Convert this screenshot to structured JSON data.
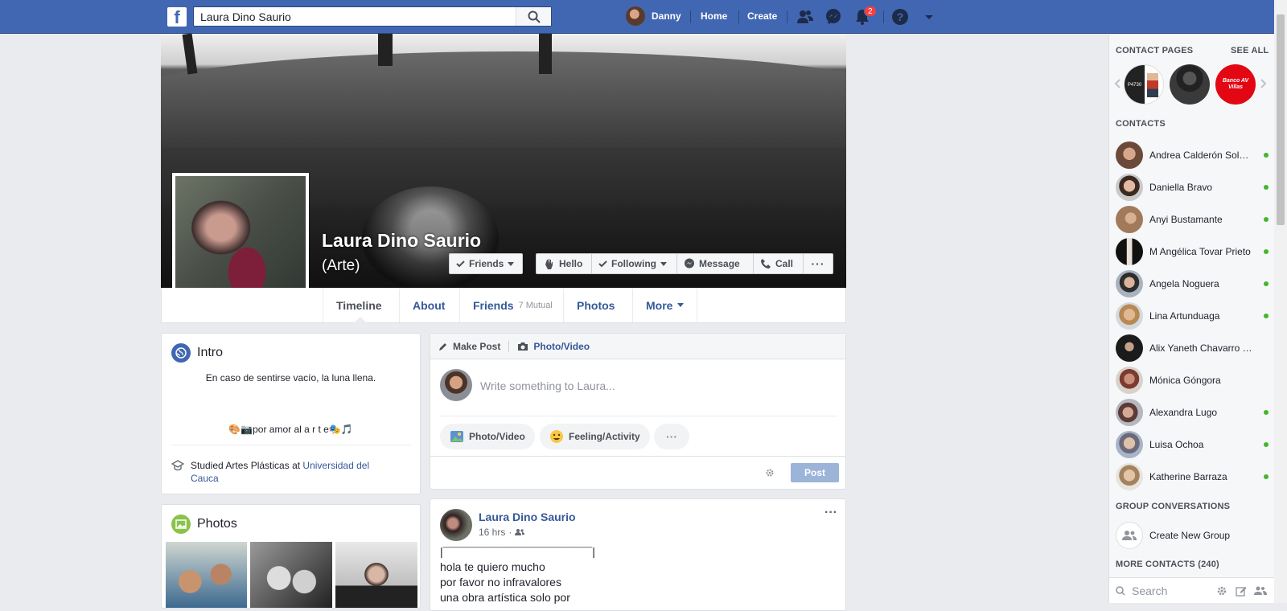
{
  "topbar": {
    "search_value": "Laura Dino Saurio",
    "user_name": "Danny",
    "home": "Home",
    "create": "Create",
    "notifications_count": "2",
    "colors": {
      "brand": "#4267b2",
      "badge": "#fa3e3e"
    }
  },
  "profile": {
    "name": "Laura Dino Saurio",
    "alt_name": "(Arte)",
    "buttons": {
      "friends": "Friends",
      "hello": "Hello",
      "following": "Following",
      "message": "Message",
      "call": "Call"
    }
  },
  "tabs": {
    "timeline": "Timeline",
    "about": "About",
    "friends": "Friends",
    "mutual": "7 Mutual",
    "photos": "Photos",
    "more": "More"
  },
  "intro": {
    "title": "Intro",
    "bio": "En caso de sentirse vacío, la luna llena.",
    "tagline": "🎨📷por amor al a r t e🎭🎵",
    "studied_prefix": "Studied Artes Plásticas at ",
    "studied_link": "Universidad del Cauca"
  },
  "photos_card": {
    "title": "Photos"
  },
  "composer": {
    "make_post": "Make Post",
    "photo_video_tab": "Photo/Video",
    "placeholder": "Write something to Laura...",
    "photo_video": "Photo/Video",
    "feeling": "Feeling/Activity",
    "post": "Post"
  },
  "post": {
    "author": "Laura Dino Saurio",
    "time": "16 hrs",
    "line0": "|¯¯¯¯¯¯¯¯¯¯¯¯¯¯¯¯¯¯¯¯¯¯¯¯|",
    "line1": "hola te quiero mucho",
    "line2": "por favor no infravalores",
    "line3": "una obra artística solo por"
  },
  "sidebar": {
    "contact_pages": "CONTACT PAGES",
    "see_all": "SEE ALL",
    "page_badge_text": "P4730",
    "bank_text": "Banco AV Villas",
    "contacts_title": "CONTACTS",
    "contacts": [
      "Andrea Calderón Sol…",
      "Daniella Bravo",
      "Anyi Bustamante",
      "M Angélica Tovar Prieto",
      "Angela Noguera",
      "Lina Artunduaga",
      "Alix Yaneth Chavarro …",
      "Mónica Góngora",
      "Alexandra Lugo",
      "Luisa Ochoa",
      "Katherine Barraza"
    ],
    "group_title": "GROUP CONVERSATIONS",
    "create_group": "Create New Group",
    "more_contacts": "MORE CONTACTS (240)",
    "search_placeholder": "Search"
  }
}
